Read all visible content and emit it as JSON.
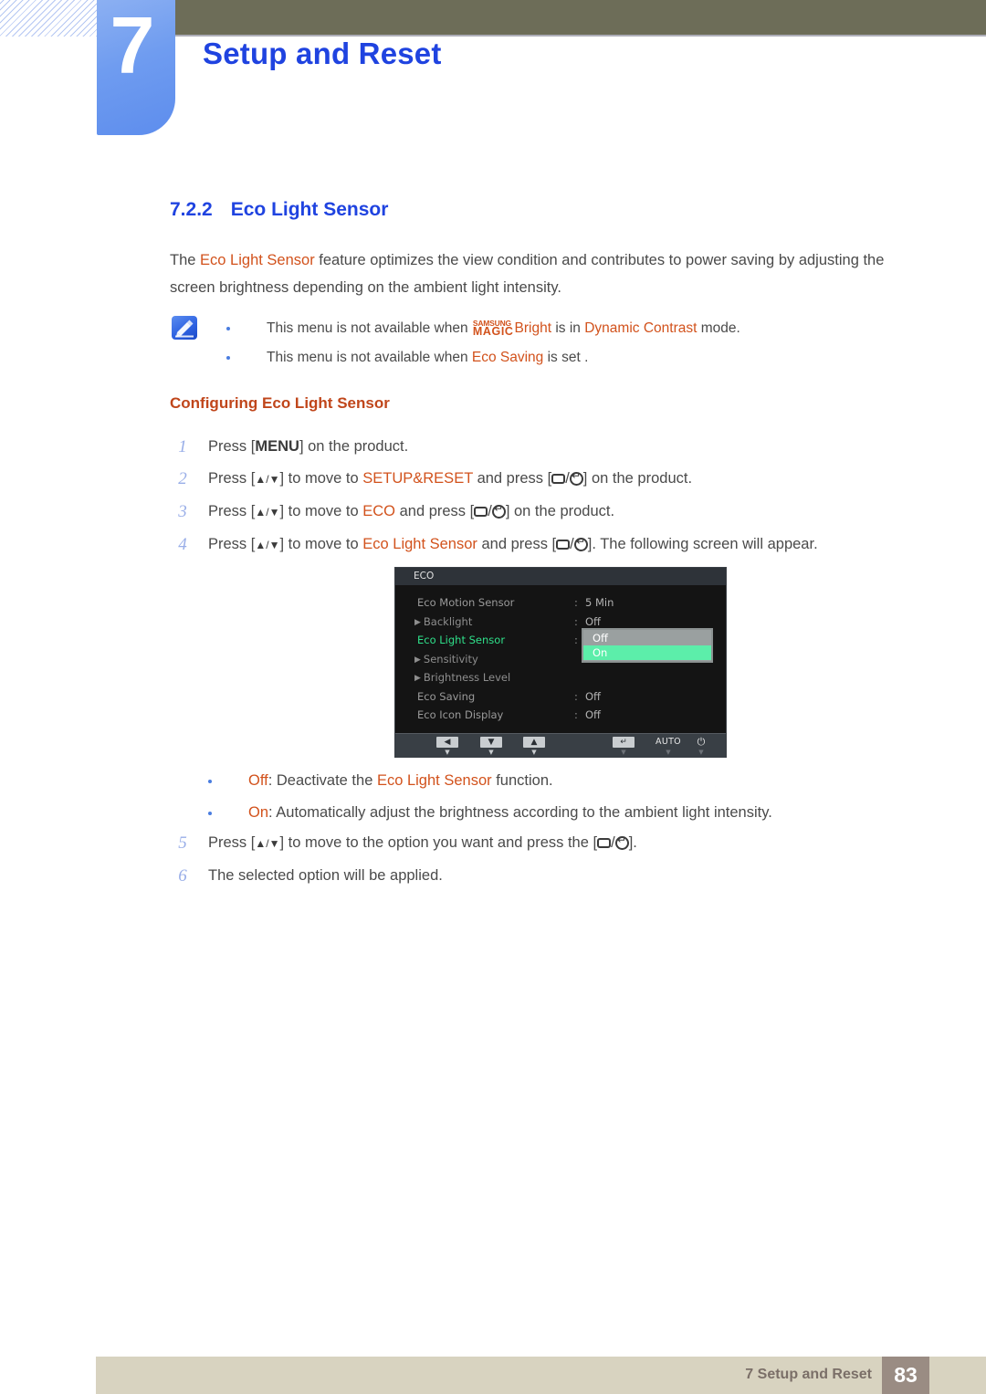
{
  "header": {
    "chapter_number": "7",
    "chapter_title": "Setup and Reset"
  },
  "section": {
    "number": "7.2.2",
    "title": "Eco Light Sensor"
  },
  "intro": {
    "part1": "The ",
    "highlight": "Eco Light Sensor",
    "part2": " feature optimizes the view condition and contributes to power saving by adjusting the screen brightness depending on the ambient light intensity."
  },
  "note": {
    "icon": "note-pencil-icon",
    "items": [
      {
        "pre": "This menu is not available when ",
        "magic_top": "SAMSUNG",
        "magic_bottom": "MAGIC",
        "magic_suffix": "Bright",
        "mid": " is in ",
        "highlight": "Dynamic Contrast",
        "post": " mode."
      },
      {
        "pre": "This menu is not available when ",
        "highlight": "Eco Saving",
        "post": " is set ."
      }
    ]
  },
  "sub_heading": "Configuring Eco Light Sensor",
  "steps": [
    {
      "n": "1",
      "pre": "Press [",
      "key": "MENU",
      "post": "] on the product."
    },
    {
      "n": "2",
      "pre": "Press [",
      "arrows": "▲/▼",
      "mid": "] to move to ",
      "highlight": "SETUP&RESET",
      "mid2": " and press [",
      "sep": "/",
      "post": "] on the product."
    },
    {
      "n": "3",
      "pre": "Press [",
      "arrows": "▲/▼",
      "mid": "] to move to ",
      "highlight": "ECO",
      "mid2": " and press [",
      "sep": "/",
      "post": "] on the product."
    },
    {
      "n": "4",
      "pre": "Press [",
      "arrows": "▲/▼",
      "mid": "] to move to ",
      "highlight": "Eco Light Sensor",
      "mid2": " and press [",
      "sep": "/",
      "post": "]. The following screen will appear."
    },
    {
      "n": "5",
      "pre": "Press [",
      "arrows": "▲/▼",
      "mid": "] to move to the option you want and press the [",
      "sep": "/",
      "post": "]."
    },
    {
      "n": "6",
      "pre": "The selected option will be applied."
    }
  ],
  "options": [
    {
      "name": "Off",
      "pre": ": Deactivate the ",
      "highlight": "Eco Light Sensor",
      "post": " function."
    },
    {
      "name": "On",
      "pre": ": Automatically adjust the brightness according to the ambient light intensity.",
      "highlight": "",
      "post": ""
    }
  ],
  "osd": {
    "title": "ECO",
    "rows": [
      {
        "label": "Eco Motion Sensor",
        "arrow": "",
        "style": "normal",
        "colon": ":",
        "value": "5 Min"
      },
      {
        "label": "Backlight",
        "arrow": "▶",
        "style": "sub",
        "colon": ":",
        "value": "Off"
      },
      {
        "label": "Eco Light Sensor",
        "arrow": "",
        "style": "selected",
        "colon": ":",
        "value": ""
      },
      {
        "label": "Sensitivity",
        "arrow": "▶",
        "style": "sub",
        "colon": "",
        "value": ""
      },
      {
        "label": "Brightness Level",
        "arrow": "▶",
        "style": "sub",
        "colon": "",
        "value": ""
      },
      {
        "label": "Eco Saving",
        "arrow": "",
        "style": "normal",
        "colon": ":",
        "value": "Off"
      },
      {
        "label": "Eco Icon Display",
        "arrow": "",
        "style": "normal",
        "colon": ":",
        "value": "Off"
      }
    ],
    "dropdown": {
      "options": [
        "Off",
        "On"
      ],
      "selected": "On"
    },
    "toolbar": [
      {
        "glyph": "◀",
        "tick": "▼",
        "name": "left"
      },
      {
        "glyph": "▼",
        "tick": "▼",
        "name": "down"
      },
      {
        "glyph": "▲",
        "tick": "▼",
        "name": "up"
      },
      {
        "glyph": "↵",
        "tick": "▼",
        "name": "enter"
      },
      {
        "glyph": "AUTO",
        "tick": "▼",
        "name": "auto"
      },
      {
        "glyph": "⏻",
        "tick": "▼",
        "name": "power"
      }
    ],
    "colors": {
      "background": "#141414",
      "selected_text": "#2fe08a",
      "highlight_bar": "#5ceeaa"
    }
  },
  "footer": {
    "text": "7 Setup and Reset",
    "page_number": "83"
  },
  "colors": {
    "accent_blue": "#1f43e0",
    "accent_orange": "#d2521c",
    "heading_orange": "#c0461b",
    "olive": "#6d6d58",
    "footer_beige": "#d8d3c0",
    "footer_taupe": "#9a8c83"
  }
}
